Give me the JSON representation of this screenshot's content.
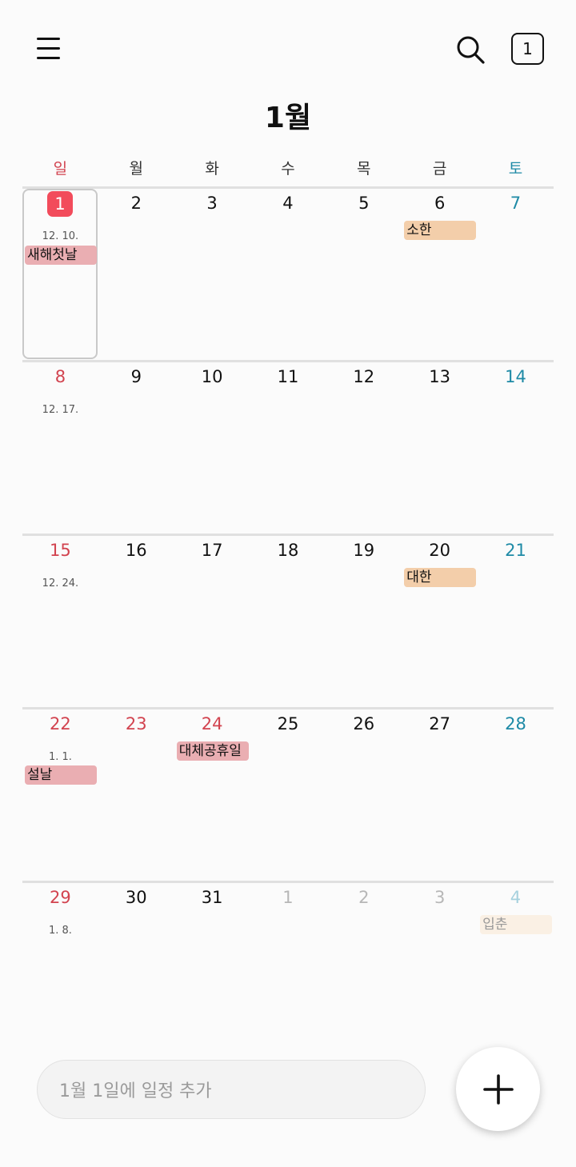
{
  "header": {
    "month_title": "1월",
    "today_button_label": "1"
  },
  "weekdays": [
    "일",
    "월",
    "화",
    "수",
    "목",
    "금",
    "토"
  ],
  "weeks": [
    {
      "days": [
        "1",
        "2",
        "3",
        "4",
        "5",
        "6",
        "7"
      ],
      "lunar": "12. 10.",
      "events": [
        {
          "col": 0,
          "label": "새해첫날",
          "kind": "holiday"
        },
        {
          "col": 5,
          "label": "소한",
          "kind": "term",
          "row": 0
        }
      ]
    },
    {
      "days": [
        "8",
        "9",
        "10",
        "11",
        "12",
        "13",
        "14"
      ],
      "lunar": "12. 17.",
      "events": []
    },
    {
      "days": [
        "15",
        "16",
        "17",
        "18",
        "19",
        "20",
        "21"
      ],
      "lunar": "12. 24.",
      "events": [
        {
          "col": 5,
          "label": "대한",
          "kind": "term",
          "row": 0
        }
      ]
    },
    {
      "days": [
        "22",
        "23",
        "24",
        "25",
        "26",
        "27",
        "28"
      ],
      "lunar": "1. 1.",
      "red_days": [
        1,
        2
      ],
      "events": [
        {
          "col": 2,
          "label": "대체공휴일",
          "kind": "holiday",
          "row": 0
        },
        {
          "col": 0,
          "label": "설날",
          "kind": "holiday",
          "row": 1
        }
      ]
    },
    {
      "days": [
        "29",
        "30",
        "31",
        "1",
        "2",
        "3",
        "4"
      ],
      "lunar": "1. 8.",
      "other_month_from": 3,
      "events": [
        {
          "col": 6,
          "label": "입춘",
          "kind": "faded",
          "row": 0
        }
      ]
    }
  ],
  "add_event": {
    "placeholder": "1월 1일에 일정 추가"
  },
  "icons": {
    "menu": "hamburger-icon",
    "search": "search-icon",
    "add": "plus-icon"
  },
  "colors": {
    "sunday": "#d2434f",
    "saturday": "#1e8aa6",
    "today_badge": "#f24b5b",
    "holiday_event": "#eaaeb2",
    "solar_term_event": "#f3ceaa"
  }
}
